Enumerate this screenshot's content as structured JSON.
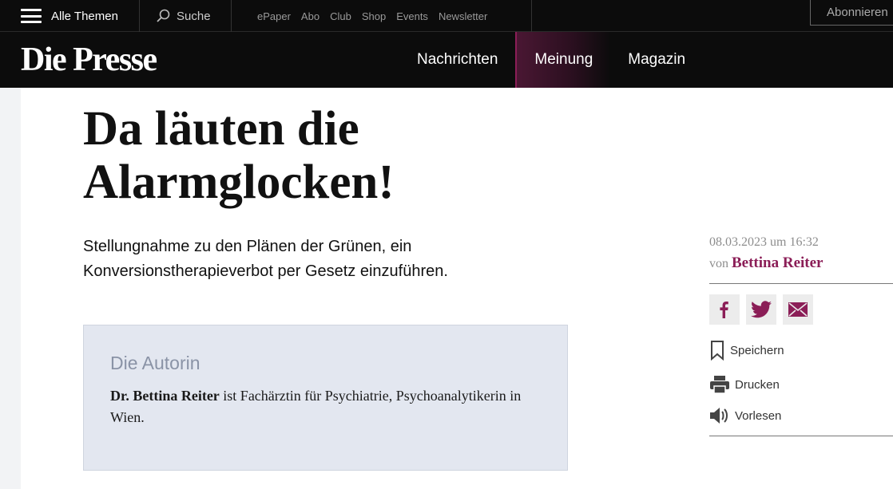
{
  "topbar": {
    "menu_label": "Alle Themen",
    "search_label": "Suche",
    "links": [
      "ePaper",
      "Abo",
      "Club",
      "Shop",
      "Events",
      "Newsletter"
    ],
    "subscribe_label": "Abonnieren"
  },
  "header": {
    "logo": "Die Presse",
    "nav": [
      "Nachrichten",
      "Meinung",
      "Magazin"
    ],
    "active_nav": "Meinung"
  },
  "article": {
    "headline": "Da läuten die Alarmglocken!",
    "lead": "Stellungnahme zu den Plänen der Grünen, ein Konversionstherapieverbot per Gesetz einzuführen.",
    "author_box": {
      "title": "Die Autorin",
      "name": "Dr. Bettina Reiter",
      "bio": " ist Fachärztin für Psychiatrie, Psychoanalytikerin in Wien."
    }
  },
  "meta": {
    "date": "08.03.2023 um 16:32",
    "by_prefix": "von",
    "author": "Bettina Reiter"
  },
  "share": {
    "icons": [
      "facebook-icon",
      "twitter-icon",
      "mail-icon"
    ]
  },
  "actions": {
    "save": "Speichern",
    "print": "Drucken",
    "read_aloud": "Vorlesen"
  },
  "colors": {
    "brand": "#8b1e57",
    "header_bg": "#0c0c0c",
    "author_box_bg": "#e3e7f0"
  }
}
